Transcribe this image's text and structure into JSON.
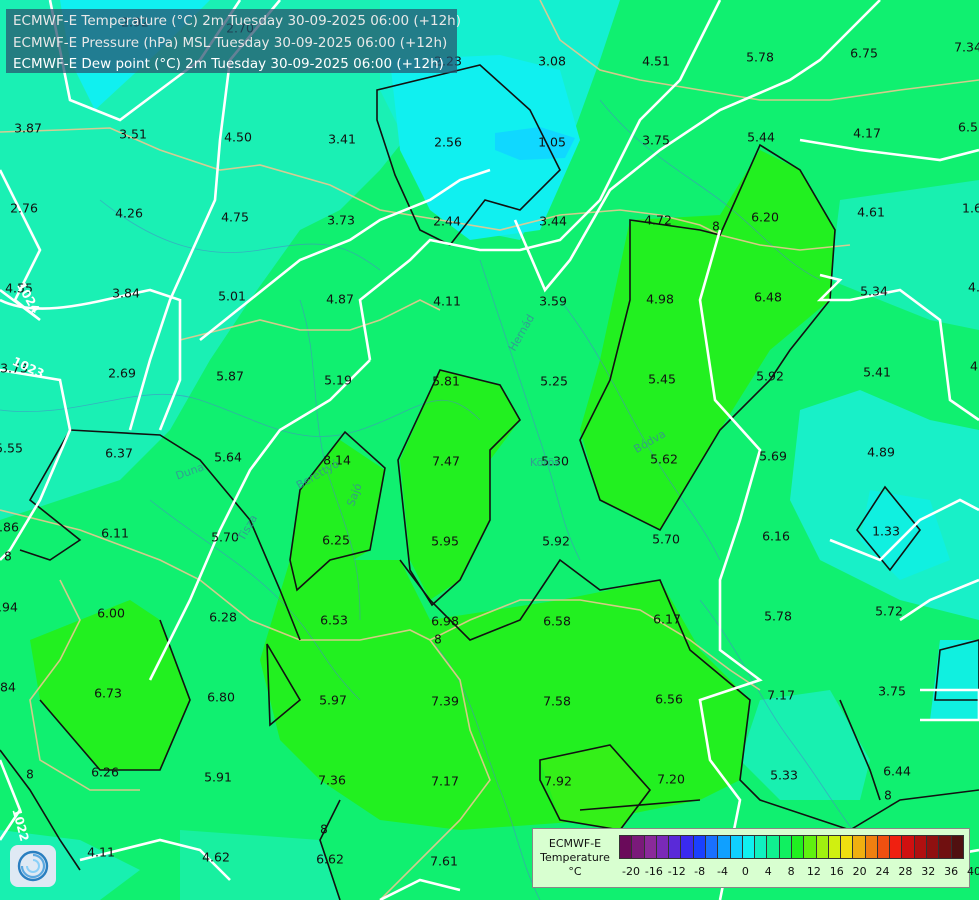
{
  "titles": [
    "ECMWF-E Temperature (°C) 2m Tuesday 30-09-2025 06:00 (+12h)",
    "ECMWF-E Pressure (hPa) MSL Tuesday 30-09-2025 06:00 (+12h)",
    "ECMWF-E Dew point (°C) 2m Tuesday 30-09-2025 06:00 (+12h)"
  ],
  "grid_values": [
    {
      "v": "2.92"
    },
    {
      "v": "2.70"
    },
    {
      "v": "2.23"
    },
    {
      "v": "3.08"
    },
    {
      "v": "4.51"
    },
    {
      "v": "5.78"
    },
    {
      "v": "6.75"
    },
    {
      "v": "7.34"
    },
    {
      "v": "3.87"
    },
    {
      "v": "3.51"
    },
    {
      "v": "4.50"
    },
    {
      "v": "3.41"
    },
    {
      "v": "2.56"
    },
    {
      "v": "1.05"
    },
    {
      "v": "3.75"
    },
    {
      "v": "5.44"
    },
    {
      "v": "4.17"
    },
    {
      "v": "6.5"
    },
    {
      "v": "2.76"
    },
    {
      "v": "4.26"
    },
    {
      "v": "4.75"
    },
    {
      "v": "3.73"
    },
    {
      "v": "2.44"
    },
    {
      "v": "3.44"
    },
    {
      "v": "4.72"
    },
    {
      "v": "6.20"
    },
    {
      "v": "4.61"
    },
    {
      "v": "1.6"
    },
    {
      "v": "4.55"
    },
    {
      "v": "3.84"
    },
    {
      "v": "5.01"
    },
    {
      "v": "4.87"
    },
    {
      "v": "4.11"
    },
    {
      "v": "3.59"
    },
    {
      "v": "4.98"
    },
    {
      "v": "6.48"
    },
    {
      "v": "5.34"
    },
    {
      "v": "4."
    },
    {
      "v": "3.73"
    },
    {
      "v": "2.69"
    },
    {
      "v": "5.87"
    },
    {
      "v": "5.19"
    },
    {
      "v": "5.81"
    },
    {
      "v": "5.25"
    },
    {
      "v": "5.45"
    },
    {
      "v": "5.92"
    },
    {
      "v": "5.41"
    },
    {
      "v": "4."
    },
    {
      "v": "5.55"
    },
    {
      "v": "6.37"
    },
    {
      "v": "5.64"
    },
    {
      "v": "8.14"
    },
    {
      "v": "7.47"
    },
    {
      "v": "5.30"
    },
    {
      "v": "5.62"
    },
    {
      "v": "5.69"
    },
    {
      "v": "4.89"
    },
    {
      "v": "5.86"
    },
    {
      "v": "6.11"
    },
    {
      "v": "5.70"
    },
    {
      "v": "6.25"
    },
    {
      "v": "5.95"
    },
    {
      "v": "5.92"
    },
    {
      "v": "5.70"
    },
    {
      "v": "6.16"
    },
    {
      "v": "1.33"
    },
    {
      "v": "5.94"
    },
    {
      "v": "6.00"
    },
    {
      "v": "6.28"
    },
    {
      "v": "6.53"
    },
    {
      "v": "6.98"
    },
    {
      "v": "6.58"
    },
    {
      "v": "6.17"
    },
    {
      "v": "5.78"
    },
    {
      "v": "5.72"
    },
    {
      "v": "6.84"
    },
    {
      "v": "6.73"
    },
    {
      "v": "6.80"
    },
    {
      "v": "5.97"
    },
    {
      "v": "7.39"
    },
    {
      "v": "7.58"
    },
    {
      "v": "6.56"
    },
    {
      "v": "7.17"
    },
    {
      "v": "3.75"
    },
    {
      "v": "6.26"
    },
    {
      "v": "5.91"
    },
    {
      "v": "7.36"
    },
    {
      "v": "7.17"
    },
    {
      "v": "7.92"
    },
    {
      "v": "7.20"
    },
    {
      "v": "5.33"
    },
    {
      "v": "6.44"
    },
    {
      "v": "4.11"
    },
    {
      "v": "4.62"
    },
    {
      "v": "6.62"
    },
    {
      "v": "7.61"
    },
    {
      "v": "5.50"
    }
  ],
  "contour_labels": [
    "8",
    "8",
    "8",
    "8",
    "8",
    "8"
  ],
  "isobar_labels": [
    "1024",
    "1023",
    "1022"
  ],
  "river_labels": [
    "Hernád",
    "Bódva",
    "Tisza",
    "Sajó",
    "Körös",
    "Berettyó",
    "Duna"
  ],
  "legend": {
    "title_line1": "ECMWF-E",
    "title_line2": "Temperature",
    "title_line3": "°C",
    "colors": [
      "#6a0a5a",
      "#7a1a7a",
      "#8a2a9a",
      "#7a2ab8",
      "#5a2ad8",
      "#3a2af0",
      "#1a40ff",
      "#1a70ff",
      "#10a0ff",
      "#10d0ff",
      "#10f0f0",
      "#10f0c0",
      "#10f090",
      "#10f060",
      "#20f020",
      "#60f010",
      "#a0f010",
      "#d0f010",
      "#f0e010",
      "#f0b010",
      "#f08010",
      "#f05010",
      "#f02010",
      "#d01010",
      "#b01010",
      "#901010",
      "#701010",
      "#501010"
    ],
    "ticks": [
      "-20",
      "-16",
      "-12",
      "-8",
      "-4",
      "0",
      "4",
      "8",
      "12",
      "16",
      "20",
      "24",
      "28",
      "32",
      "36",
      "40"
    ]
  }
}
